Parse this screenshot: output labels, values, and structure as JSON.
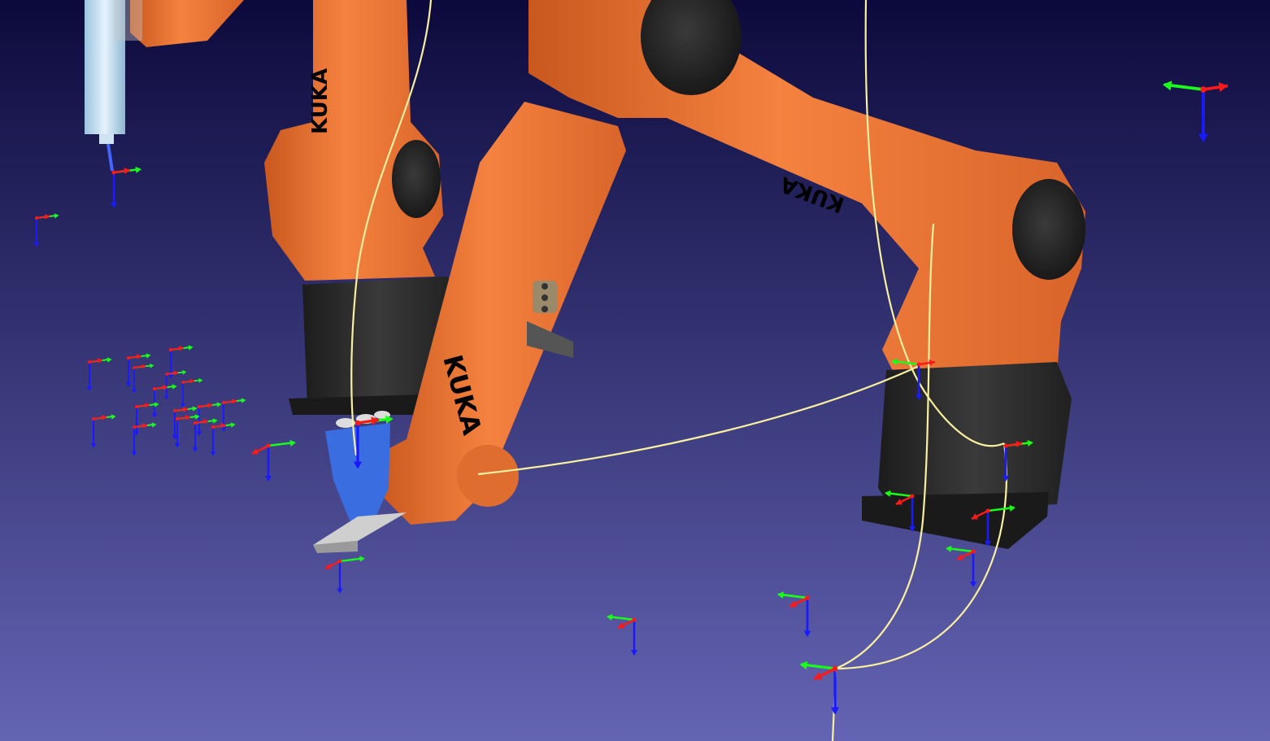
{
  "viewer": {
    "background_top": "#0c0a3c",
    "background_bottom": "#6464b4",
    "robot_orange": "#f07838",
    "robot_dark": "#2e2e2e",
    "path_color": "#f8f0a0",
    "axis_x_color": "#ff1a1a",
    "axis_y_color": "#1aff1a",
    "axis_z_color": "#1a1aff"
  },
  "robots": [
    {
      "name": "left-robot",
      "brand_label": "KUKA"
    },
    {
      "name": "middle-robot-arm",
      "brand_label": "KUKA"
    },
    {
      "name": "right-robot",
      "brand_label": "KUKA"
    }
  ],
  "icons": {
    "frame": "coordinate-frame-icon",
    "tool": "spray-tool-icon",
    "gripper": "gripper-icon"
  }
}
